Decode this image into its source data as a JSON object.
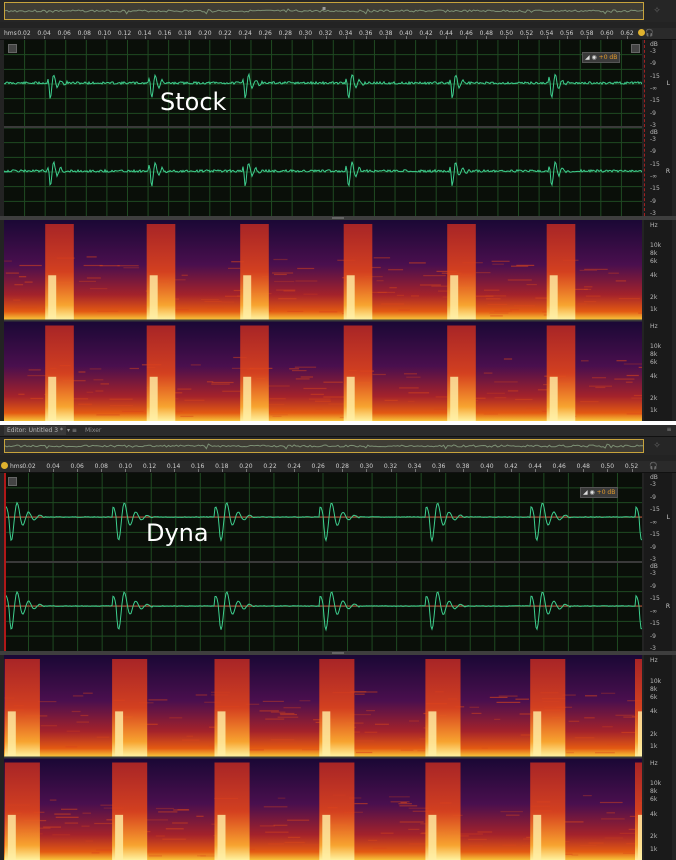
{
  "colors": {
    "waveform": "#3ecf8e",
    "waveform_baseline": "#c0483a",
    "grid": "#1f4a22",
    "overview_border": "#c7a33c",
    "playhead": "#e0b22e",
    "gain_text": "#e39a2a"
  },
  "stock": {
    "overlay_label": "Stock",
    "ruler": {
      "unit": "hms",
      "ticks": [
        "0.02",
        "0.04",
        "0.06",
        "0.08",
        "0.10",
        "0.12",
        "0.14",
        "0.16",
        "0.18",
        "0.20",
        "0.22",
        "0.24",
        "0.26",
        "0.28",
        "0.30",
        "0.32",
        "0.34",
        "0.36",
        "0.38",
        "0.40",
        "0.42",
        "0.44",
        "0.46",
        "0.48",
        "0.50",
        "0.52",
        "0.54",
        "0.56",
        "0.58",
        "0.60",
        "0.62"
      ]
    },
    "gain_control": {
      "value": "+0 dB"
    },
    "waveform_scale": {
      "unit": "dB",
      "labels": [
        "-3",
        "-9",
        "-15",
        "-∞",
        "-15",
        "-9",
        "-3"
      ],
      "channel_left": "L",
      "channel_right": "R"
    },
    "spectral_scale": {
      "unit": "Hz",
      "labels": [
        "10k",
        "8k",
        "6k",
        "4k",
        "2k",
        "1k"
      ]
    },
    "transients_s": [
      0.046,
      0.147,
      0.24,
      0.343,
      0.446,
      0.545
    ]
  },
  "dyna": {
    "overlay_label": "Dyna",
    "tabs": [
      {
        "label": "Editor: Untitled 3 *",
        "active": true
      },
      {
        "label": "Mixer",
        "active": false
      }
    ],
    "ruler": {
      "unit": "hms",
      "ticks": [
        "0.02",
        "0.04",
        "0.06",
        "0.08",
        "0.10",
        "0.12",
        "0.14",
        "0.16",
        "0.18",
        "0.20",
        "0.22",
        "0.24",
        "0.26",
        "0.28",
        "0.30",
        "0.32",
        "0.34",
        "0.36",
        "0.38",
        "0.40",
        "0.42",
        "0.44",
        "0.46",
        "0.48",
        "0.50",
        "0.52"
      ]
    },
    "gain_control": {
      "value": "+0 dB"
    },
    "waveform_scale": {
      "unit": "dB",
      "labels": [
        "-3",
        "-9",
        "-15",
        "-∞",
        "-15",
        "-9",
        "-3"
      ],
      "channel_left": "L",
      "channel_right": "R"
    },
    "spectral_scale": {
      "unit": "Hz",
      "labels": [
        "10k",
        "8k",
        "6k",
        "4k",
        "2k",
        "1k"
      ]
    },
    "transients_s": [
      0.004,
      0.093,
      0.178,
      0.265,
      0.353,
      0.44,
      0.527
    ]
  }
}
